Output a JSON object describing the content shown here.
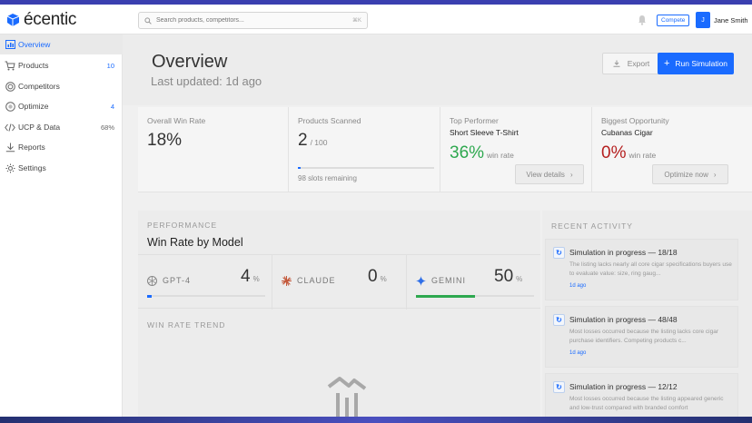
{
  "app": {
    "name": "écentic"
  },
  "search": {
    "placeholder": "Search products, competitors...",
    "shortcut": "⌘K"
  },
  "topbar": {
    "compete_label": "Compete",
    "avatar_initial": "J",
    "user_name": "Jane Smith"
  },
  "sidebar": {
    "items": [
      {
        "label": "Overview",
        "badge": "",
        "icon": "bar-chart-icon",
        "active": true
      },
      {
        "label": "Products",
        "badge": "10",
        "icon": "cart-icon"
      },
      {
        "label": "Competitors",
        "badge": "",
        "icon": "target-icon"
      },
      {
        "label": "Optimize",
        "badge": "4",
        "icon": "gauge-icon"
      },
      {
        "label": "UCP & Data",
        "badge": "68%",
        "icon": "code-icon"
      },
      {
        "label": "Reports",
        "badge": "",
        "icon": "download-icon"
      },
      {
        "label": "Settings",
        "badge": "",
        "icon": "gear-icon"
      }
    ]
  },
  "header": {
    "title": "Overview",
    "subtitle": "Last updated: 1d ago",
    "export_label": "Export",
    "run_label": "Run Simulation"
  },
  "stats": {
    "win_rate": {
      "label": "Overall Win Rate",
      "value": "18%"
    },
    "scanned": {
      "label": "Products Scanned",
      "value": "2",
      "total": "/ 100",
      "progress": 0.02,
      "note": "98 slots remaining"
    },
    "top": {
      "label": "Top Performer",
      "product": "Short Sleeve T-Shirt",
      "value": "36%",
      "unit": "win rate",
      "button": "View details"
    },
    "opportunity": {
      "label": "Biggest Opportunity",
      "product": "Cubanas Cigar",
      "value": "0%",
      "unit": "win rate",
      "button": "Optimize now"
    }
  },
  "performance": {
    "section": "PERFORMANCE",
    "title": "Win Rate by Model",
    "models": [
      {
        "name": "GPT-4",
        "value": "4",
        "unit": "%",
        "fraction": 0.04
      },
      {
        "name": "CLAUDE",
        "value": "0",
        "unit": "%",
        "fraction": 0
      },
      {
        "name": "GEMINI",
        "value": "50",
        "unit": "%",
        "fraction": 0.5
      }
    ],
    "trend_label": "WIN RATE TREND"
  },
  "activity": {
    "section": "RECENT ACTIVITY",
    "items": [
      {
        "title": "Simulation in progress — 18/18",
        "desc": "The listing lacks nearly all core cigar specifications buyers use to evaluate value: size, ring gaug...",
        "time": "1d ago"
      },
      {
        "title": "Simulation in progress — 48/48",
        "desc": "Most losses occurred because the listing lacks core cigar purchase identifiers. Competing products c...",
        "time": "1d ago"
      },
      {
        "title": "Simulation in progress — 12/12",
        "desc": "Most losses occurred because the listing appeared generic and low-trust compared with branded comfort",
        "time": ""
      }
    ]
  },
  "colors": {
    "accent": "#1a6bff",
    "positive": "#2ea84f",
    "negative": "#b52020"
  }
}
